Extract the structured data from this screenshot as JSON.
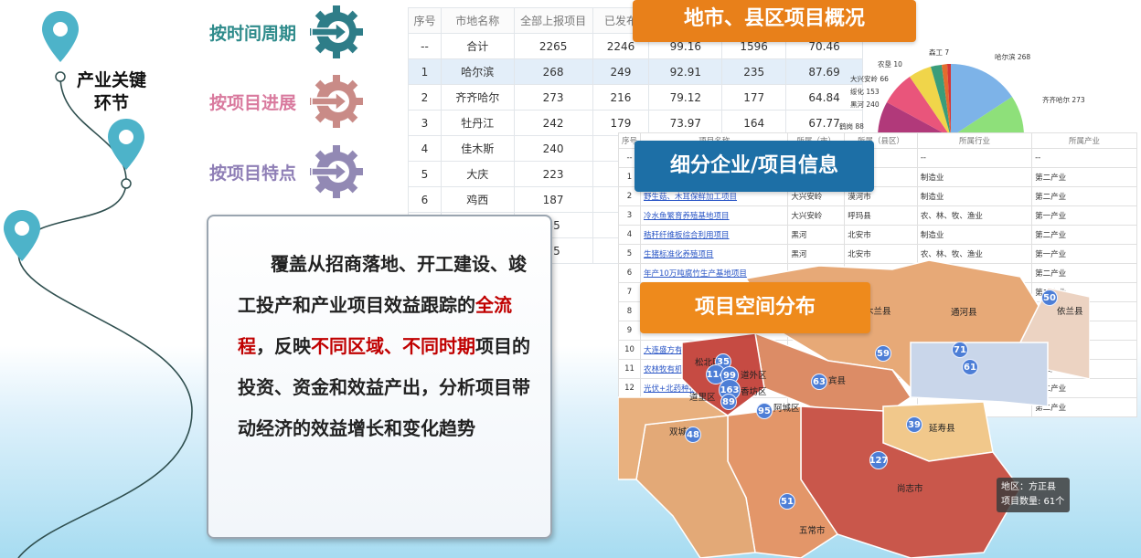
{
  "left": {
    "step_label_line1": "产业关键",
    "step_label_line2": "环节",
    "categories": [
      {
        "label": "按时间周期",
        "color": "#2e8b8b"
      },
      {
        "label": "按项目进展",
        "color": "#d97a9e"
      },
      {
        "label": "按项目特点",
        "color": "#8f7fb6"
      }
    ],
    "gear_colors": [
      "#2e7d88",
      "#c98b87",
      "#9289b4"
    ],
    "pin_color": "#4db3c9",
    "description_parts": [
      {
        "text": "覆盖从招商落地、开工建设、竣工投产和产业项目效益跟踪的",
        "red": false
      },
      {
        "text": "全流程",
        "red": true
      },
      {
        "text": "，反映",
        "red": false
      },
      {
        "text": "不同区域、不同时期",
        "red": true
      },
      {
        "text": "项目的投资、资金和效益产出，分析项目带动经济的效益增长和变化趋势",
        "red": false
      }
    ]
  },
  "banners": {
    "overview": "地市、县区项目概况",
    "enterprise": "细分企业/项目信息",
    "spatial": "项目空间分布",
    "overview_color": "#e8801a",
    "enterprise_color": "#1d6fa6",
    "spatial_color": "#ee8a1c"
  },
  "table1": {
    "headers": [
      "序号",
      "市地名称",
      "全部上报项目",
      "已发布",
      "",
      "",
      ""
    ],
    "rows": [
      [
        "--",
        "合计",
        "2265",
        "2246",
        "99.16",
        "1596",
        "70.46"
      ],
      [
        "1",
        "哈尔滨",
        "268",
        "249",
        "92.91",
        "235",
        "87.69"
      ],
      [
        "2",
        "齐齐哈尔",
        "273",
        "216",
        "79.12",
        "177",
        "64.84"
      ],
      [
        "3",
        "牡丹江",
        "242",
        "179",
        "73.97",
        "164",
        "67.77"
      ],
      [
        "4",
        "佳木斯",
        "240",
        "",
        "",
        "",
        ""
      ],
      [
        "5",
        "大庆",
        "223",
        "",
        "",
        "",
        ""
      ],
      [
        "6",
        "鸡西",
        "187",
        "",
        "",
        "",
        ""
      ],
      [
        "7",
        "",
        "35",
        "",
        "",
        "",
        ""
      ],
      [
        "8",
        "",
        "75",
        "",
        "",
        "",
        ""
      ]
    ]
  },
  "pie": {
    "labels": [
      "森工 7",
      "农垦 10",
      "大兴安岭 66",
      "绥化 153",
      "黑河 240",
      "鹤岗 88",
      "哈尔滨 268",
      "齐齐哈尔 273"
    ]
  },
  "table2": {
    "headers": [
      "序号",
      "项目名称",
      "所属（市）",
      "所属（县区）",
      "所属行业",
      "所属产业"
    ],
    "rows": [
      [
        "--",
        "",
        "",
        "",
        "--",
        "--"
      ],
      [
        "1",
        "",
        "",
        "",
        "制造业",
        "第二产业"
      ],
      [
        "2",
        "野生菇、木耳保鲜加工项目",
        "大兴安岭",
        "漠河市",
        "制造业",
        "第二产业"
      ],
      [
        "3",
        "冷水鱼繁育养殖基地项目",
        "大兴安岭",
        "呼玛县",
        "农、林、牧、渔业",
        "第一产业"
      ],
      [
        "4",
        "秸秆纤维板综合利用项目",
        "黑河",
        "北安市",
        "制造业",
        "第二产业"
      ],
      [
        "5",
        "生猪标准化养殖项目",
        "黑河",
        "北安市",
        "农、林、牧、渔业",
        "第一产业"
      ],
      [
        "6",
        "年产10万吨腐竹生产基地项目",
        "",
        "",
        "",
        "第二产业"
      ],
      [
        "7",
        "",
        "",
        "",
        "",
        "第二产业"
      ],
      [
        "8",
        "",
        "",
        "",
        "",
        "第二产业"
      ],
      [
        "9",
        "",
        "",
        "",
        "",
        "第二产业"
      ],
      [
        "10",
        "大连盛方有机...",
        "",
        "",
        "",
        "第二产业"
      ],
      [
        "11",
        "农林牧有机废弃...",
        "",
        "",
        "",
        "第二产业"
      ],
      [
        "12",
        "光伏+北药种植...",
        "",
        "",
        "",
        "第二产业"
      ],
      [
        "13",
        "...",
        "",
        "",
        "",
        "第二产业"
      ]
    ]
  },
  "map": {
    "labels": [
      "通河县",
      "宾县",
      "延寿县",
      "尚志市",
      "五常市",
      "双城区",
      "阿城区",
      "松北区",
      "道里区",
      "香坊区",
      "道外区",
      "依兰县",
      "木兰县"
    ],
    "bubbles": [
      "50",
      "59",
      "71",
      "61",
      "63",
      "39",
      "127",
      "51",
      "48",
      "95",
      "35",
      "114",
      "99",
      "163",
      "89"
    ],
    "tooltip_line1": "地区：方正县",
    "tooltip_line2": "项目数量: 61个"
  }
}
